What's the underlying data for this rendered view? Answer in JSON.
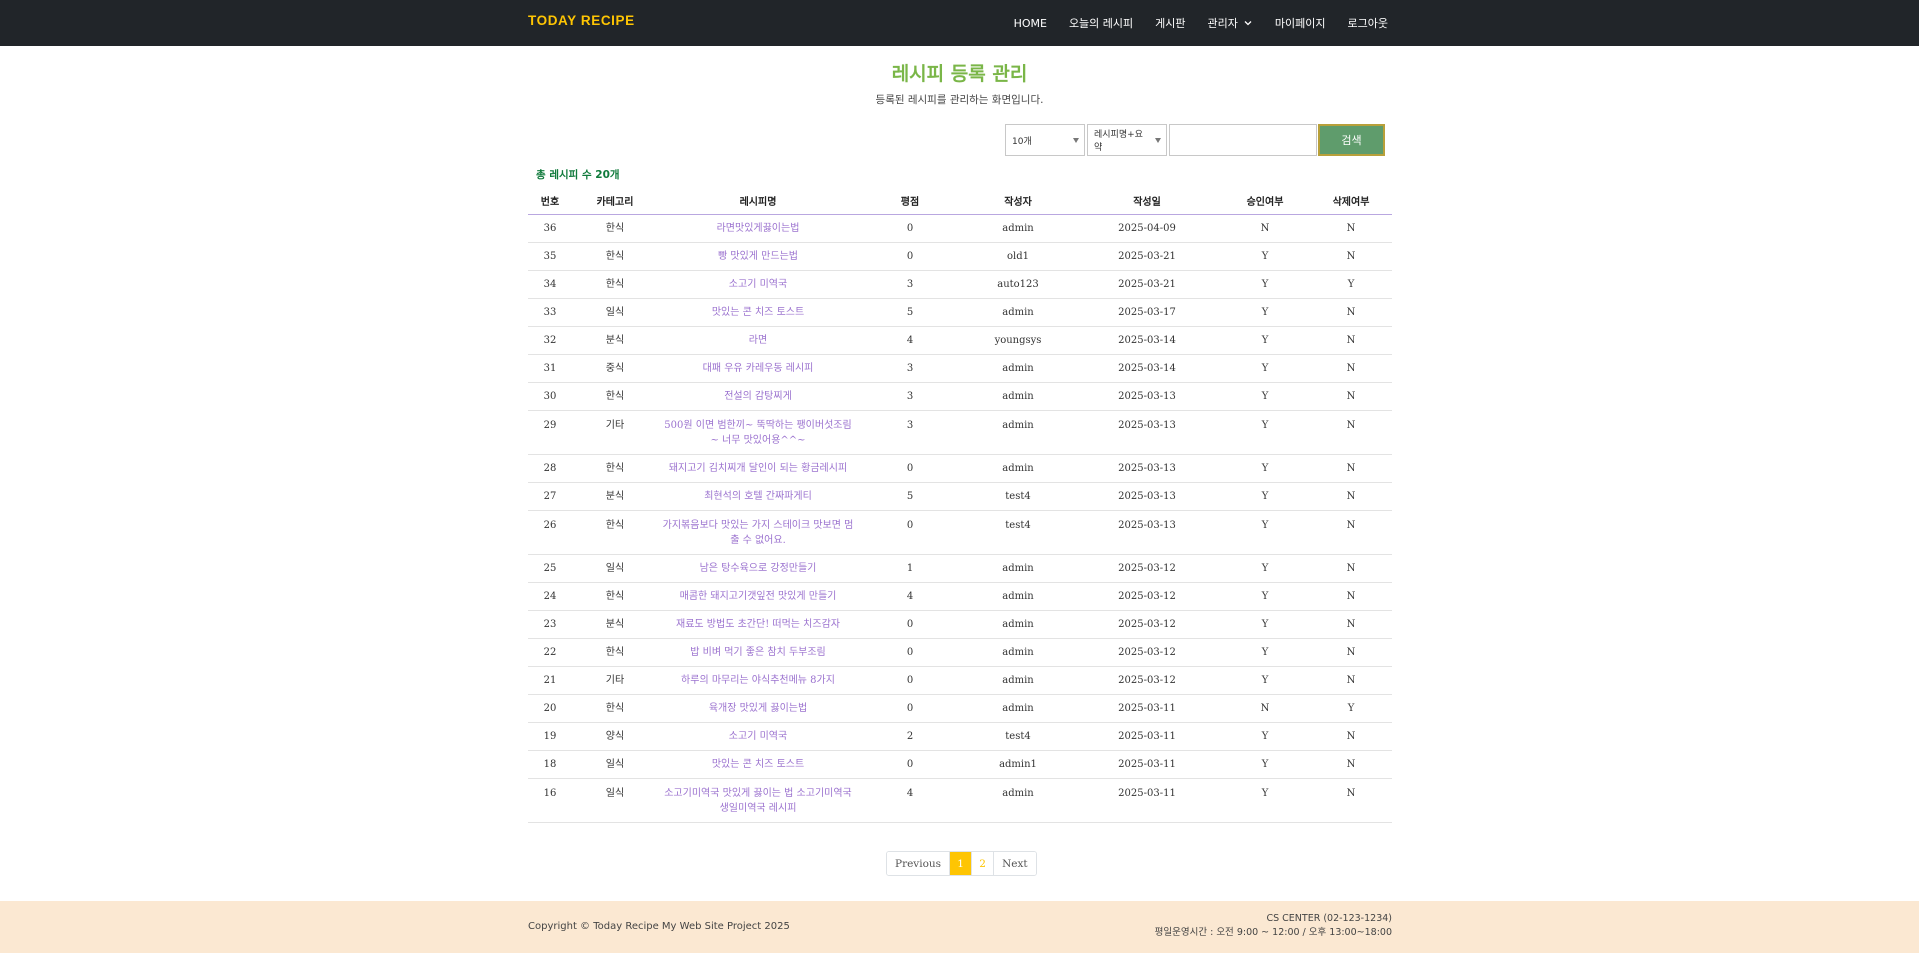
{
  "nav": {
    "brand": "TODAY RECIPE",
    "items": [
      "HOME",
      "오늘의 레시피",
      "게시판",
      "관리자",
      "마이페이지",
      "로그아웃"
    ]
  },
  "page": {
    "title": "레시피 등록 관리",
    "subtitle": "등록된 레시피를 관리하는 화면입니다."
  },
  "search": {
    "count_select": "10개",
    "type_select": "레시피명+요약",
    "query": "",
    "button_label": "검색"
  },
  "summary": {
    "total": "총 레시피 수 20개"
  },
  "table": {
    "headers": [
      "번호",
      "카테고리",
      "레시피명",
      "평점",
      "작성자",
      "작성일",
      "승인여부",
      "삭제여부"
    ],
    "rows": [
      [
        "36",
        "한식",
        "라면맛있게끓이는법",
        "0",
        "admin",
        "2025-04-09",
        "N",
        "N"
      ],
      [
        "35",
        "한식",
        "빵 맛있게 만드는법",
        "0",
        "old1",
        "2025-03-21",
        "Y",
        "N"
      ],
      [
        "34",
        "한식",
        "소고기 미역국",
        "3",
        "auto123",
        "2025-03-21",
        "Y",
        "Y"
      ],
      [
        "33",
        "일식",
        "맛있는 콘 치즈 토스트",
        "5",
        "admin",
        "2025-03-17",
        "Y",
        "N"
      ],
      [
        "32",
        "분식",
        "라면",
        "4",
        "youngsys",
        "2025-03-14",
        "Y",
        "N"
      ],
      [
        "31",
        "중식",
        "대패 우유 카레우동 레시피",
        "3",
        "admin",
        "2025-03-14",
        "Y",
        "N"
      ],
      [
        "30",
        "한식",
        "전설의 감탕찌게",
        "3",
        "admin",
        "2025-03-13",
        "Y",
        "N"
      ],
      [
        "29",
        "기타",
        "500원 이면 범한끼~ 뚝딱하는 팽이버섯조림~ 너무 맛있어용^^~",
        "3",
        "admin",
        "2025-03-13",
        "Y",
        "N"
      ],
      [
        "28",
        "한식",
        "돼지고기 김치찌개 달인이 되는 황금레시피",
        "0",
        "admin",
        "2025-03-13",
        "Y",
        "N"
      ],
      [
        "27",
        "분식",
        "최현석의 호텔 간짜파게티",
        "5",
        "test4",
        "2025-03-13",
        "Y",
        "N"
      ],
      [
        "26",
        "한식",
        "가지볶음보다 맛있는 가지 스테이크 맛보면 멈출 수 없어요.",
        "0",
        "test4",
        "2025-03-13",
        "Y",
        "N"
      ],
      [
        "25",
        "일식",
        "남은 탕수육으로 강정만들기",
        "1",
        "admin",
        "2025-03-12",
        "Y",
        "N"
      ],
      [
        "24",
        "한식",
        "매콤한 돼지고기갯잎전 맛있게 만들기",
        "4",
        "admin",
        "2025-03-12",
        "Y",
        "N"
      ],
      [
        "23",
        "분식",
        "재료도 방법도 초간단! 떠먹는 치즈감자",
        "0",
        "admin",
        "2025-03-12",
        "Y",
        "N"
      ],
      [
        "22",
        "한식",
        "밥 비벼 먹기 좋은 참치 두부조림",
        "0",
        "admin",
        "2025-03-12",
        "Y",
        "N"
      ],
      [
        "21",
        "기타",
        "하루의 마무리는 야식추천메뉴 8가지",
        "0",
        "admin",
        "2025-03-12",
        "Y",
        "N"
      ],
      [
        "20",
        "한식",
        "육개장 맛있게 끓이는법",
        "0",
        "admin",
        "2025-03-11",
        "N",
        "Y"
      ],
      [
        "19",
        "양식",
        "소고기 미역국",
        "2",
        "test4",
        "2025-03-11",
        "Y",
        "N"
      ],
      [
        "18",
        "일식",
        "맛있는 콘 치즈 토스트",
        "0",
        "admin1",
        "2025-03-11",
        "Y",
        "N"
      ],
      [
        "16",
        "일식",
        "소고기미역국 맛있게 끓이는 법 소고기미역국 생일미역국 레시피",
        "4",
        "admin",
        "2025-03-11",
        "Y",
        "N"
      ]
    ],
    "tall_rows": [
      7,
      10,
      19
    ]
  },
  "pagination": {
    "previous": "Previous",
    "pages": [
      "1",
      "2"
    ],
    "current": "1",
    "next": "Next"
  },
  "footer": {
    "copyright": "Copyright © Today Recipe My Web Site Project 2025",
    "cs_center": "CS CENTER (02-123-1234)",
    "hours": "평일운영시간 : 오전 9:00 ~ 12:00 / 오후 13:00~18:00"
  },
  "colors": {
    "navbar": "#212529",
    "brand": "#fec503",
    "title": "#7ab648",
    "link": "#9b72cf",
    "button": "#5f9c6c",
    "footer": "#fbe8d2"
  }
}
